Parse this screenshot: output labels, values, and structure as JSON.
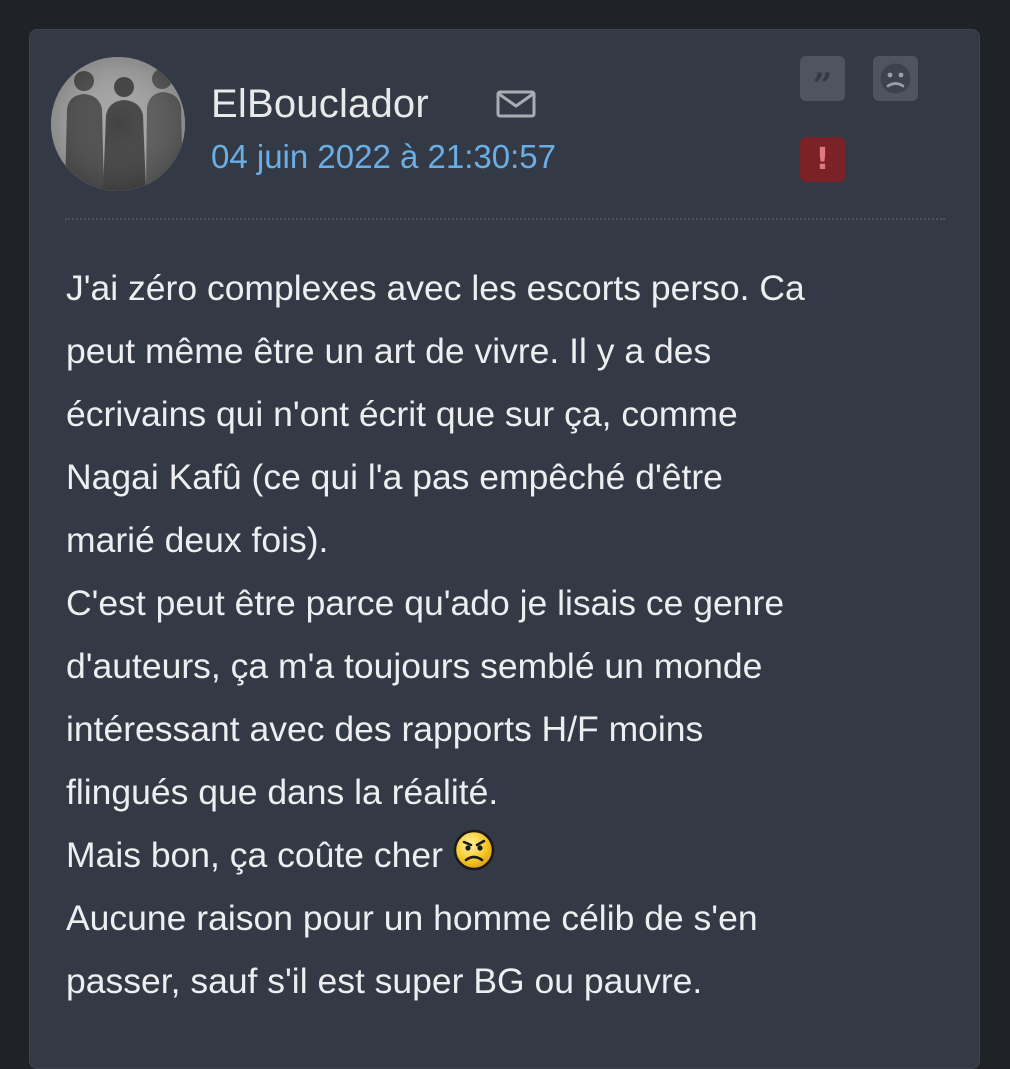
{
  "post": {
    "author": "ElBouclador",
    "date": "04 juin 2022 à 21:30:57",
    "icons": {
      "avatar": "group-silhouette-avatar",
      "message": "envelope-icon",
      "quote": "quote-icon",
      "sad": "sad-face-icon",
      "report": "exclamation-icon",
      "emoji": "annoyed-smiley-icon"
    },
    "action_glyphs": {
      "quote": "”",
      "report": "!"
    },
    "body_lines": [
      "J'ai zéro complexes avec les escorts perso. Ca",
      "peut même être un art de vivre. Il y a des",
      "écrivains qui n'ont écrit que sur ça, comme",
      "Nagai Kafû (ce qui l'a pas empêché d'être",
      "marié deux fois).",
      "C'est peut être parce qu'ado je lisais ce genre",
      "d'auteurs, ça m'a toujours semblé un monde",
      "intéressant avec des rapports H/F moins",
      "flingués que dans la réalité.",
      "Mais bon, ça coûte cher",
      "Aucune raison pour un homme célib de s'en",
      "passer, sauf s'il est super BG ou pauvre."
    ]
  },
  "colors": {
    "page_bg": "#1f2226",
    "card_bg": "#343a45",
    "date": "#6aaee6",
    "text": "#eceef0",
    "report_bg": "#7a2226"
  }
}
